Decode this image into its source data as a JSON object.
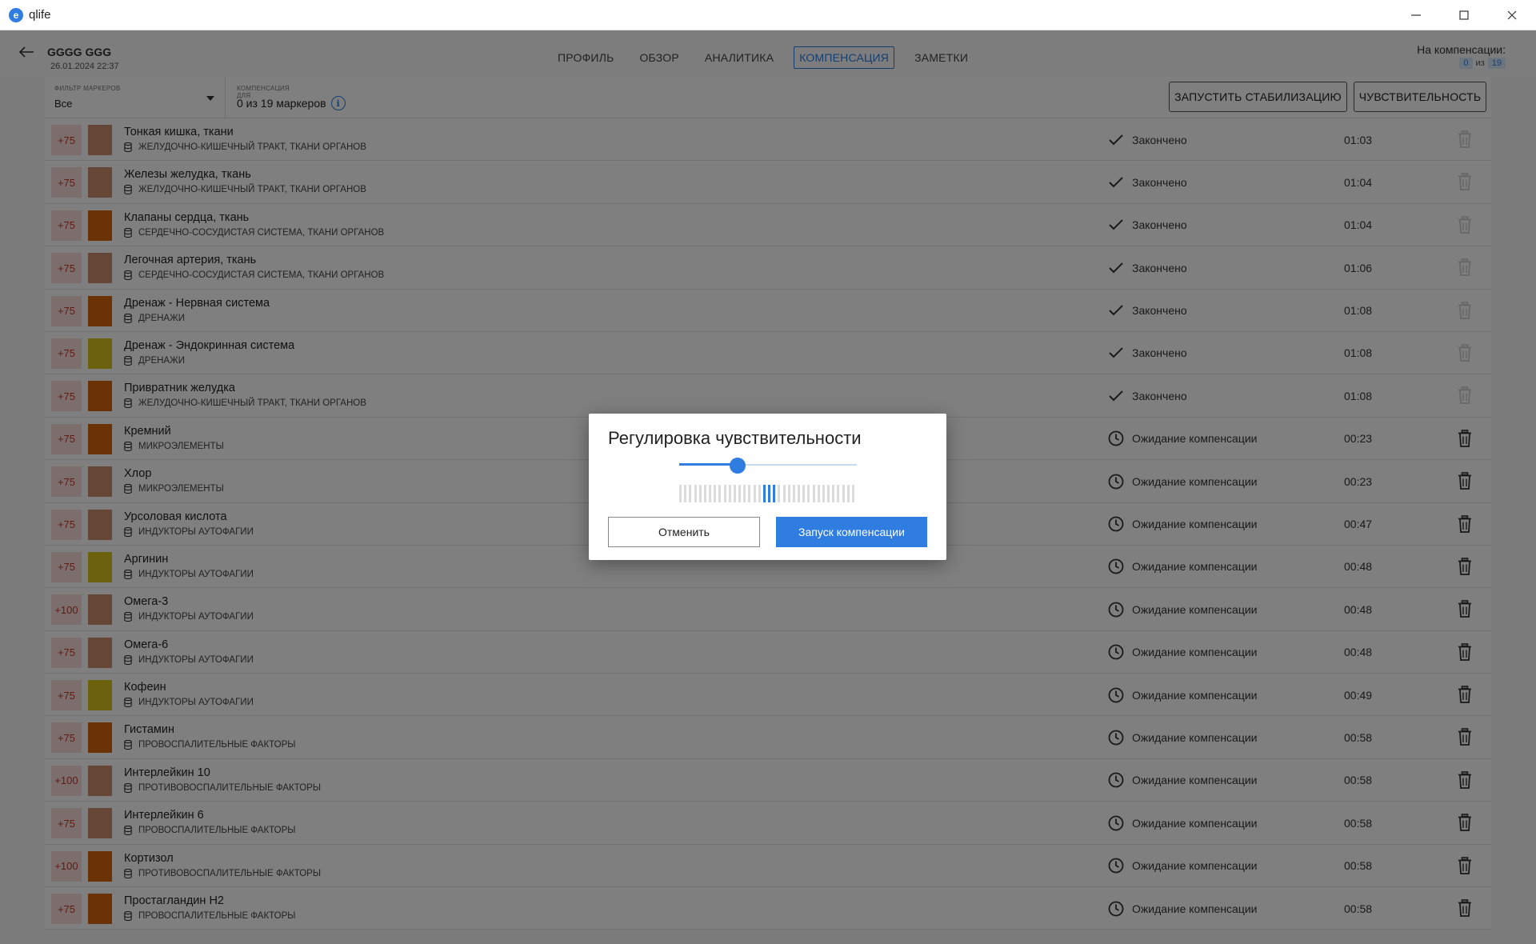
{
  "window": {
    "title": "qlife",
    "logo_letter": "e"
  },
  "header": {
    "patient_name": "GGGG GGG",
    "patient_date": "26.01.2024 22:37",
    "tabs": [
      {
        "label": "ПРОФИЛЬ"
      },
      {
        "label": "ОБЗОР"
      },
      {
        "label": "АНАЛИТИКА"
      },
      {
        "label": "КОМПЕНСАЦИЯ"
      },
      {
        "label": "ЗАМЕТКИ"
      }
    ],
    "active_tab": "КОМПЕНСАЦИЯ",
    "counter_label": "На компенсации:",
    "counter_done": "0",
    "counter_of": "из",
    "counter_total": "19"
  },
  "filterbar": {
    "filter_label": "ФИЛЬТР МАРКЕРОВ",
    "filter_value": "Все",
    "comp_label": "КОМПЕНСАЦИЯ ДЛЯ",
    "comp_value": "0 из 19 маркеров",
    "stabilize_label": "ЗАПУСТИТЬ СТАБИЛИЗАЦИЮ",
    "sensitivity_label": "ЧУВСТВИТЕЛЬНОСТЬ"
  },
  "colors": {
    "accent": "#2f7de1",
    "swatch_brown": "#cc8f6e",
    "swatch_orange": "#d6640c",
    "swatch_yellow": "#d9c21a",
    "score_text": "#c0392b",
    "score_bg": "#f7dcd9"
  },
  "rows": [
    {
      "score": "+75",
      "swatch": "brown",
      "name": "Тонкая кишка, ткани",
      "category": "ЖЕЛУДОЧНО-КИШЕЧНЫЙ ТРАКТ, ТКАНИ ОРГАНОВ",
      "status": "Закончено",
      "status_icon": "check-icon",
      "time": "01:03",
      "done": true
    },
    {
      "score": "+75",
      "swatch": "brown",
      "name": "Железы желудка, ткань",
      "category": "ЖЕЛУДОЧНО-КИШЕЧНЫЙ ТРАКТ, ТКАНИ ОРГАНОВ",
      "status": "Закончено",
      "status_icon": "check-icon",
      "time": "01:04",
      "done": true
    },
    {
      "score": "+75",
      "swatch": "orange",
      "name": "Клапаны сердца, ткань",
      "category": "СЕРДЕЧНО-СОСУДИСТАЯ СИСТЕМА, ТКАНИ ОРГАНОВ",
      "status": "Закончено",
      "status_icon": "check-icon",
      "time": "01:04",
      "done": true
    },
    {
      "score": "+75",
      "swatch": "brown",
      "name": "Легочная артерия, ткань",
      "category": "СЕРДЕЧНО-СОСУДИСТАЯ СИСТЕМА, ТКАНИ ОРГАНОВ",
      "status": "Закончено",
      "status_icon": "check-icon",
      "time": "01:06",
      "done": true
    },
    {
      "score": "+75",
      "swatch": "orange",
      "name": "Дренаж - Нервная система",
      "category": "ДРЕНАЖИ",
      "status": "Закончено",
      "status_icon": "check-icon",
      "time": "01:08",
      "done": true
    },
    {
      "score": "+75",
      "swatch": "yellow",
      "name": "Дренаж - Эндокринная система",
      "category": "ДРЕНАЖИ",
      "status": "Закончено",
      "status_icon": "check-icon",
      "time": "01:08",
      "done": true
    },
    {
      "score": "+75",
      "swatch": "orange",
      "name": "Привратник желудка",
      "category": "ЖЕЛУДОЧНО-КИШЕЧНЫЙ ТРАКТ, ТКАНИ ОРГАНОВ",
      "status": "Закончено",
      "status_icon": "check-icon",
      "time": "01:08",
      "done": true
    },
    {
      "score": "+75",
      "swatch": "orange",
      "name": "Кремний",
      "category": "МИКРОЭЛЕМЕНТЫ",
      "status": "Ожидание компенсации",
      "status_icon": "clock-icon",
      "time": "00:23",
      "done": false
    },
    {
      "score": "+75",
      "swatch": "brown",
      "name": "Хлор",
      "category": "МИКРОЭЛЕМЕНТЫ",
      "status": "Ожидание компенсации",
      "status_icon": "clock-icon",
      "time": "00:23",
      "done": false
    },
    {
      "score": "+75",
      "swatch": "brown",
      "name": "Урсоловая кислота",
      "category": "ИНДУКТОРЫ АУТОФАГИИ",
      "status": "Ожидание компенсации",
      "status_icon": "clock-icon",
      "time": "00:47",
      "done": false
    },
    {
      "score": "+75",
      "swatch": "yellow",
      "name": "Аргинин",
      "category": "ИНДУКТОРЫ АУТОФАГИИ",
      "status": "Ожидание компенсации",
      "status_icon": "clock-icon",
      "time": "00:48",
      "done": false
    },
    {
      "score": "+100",
      "swatch": "brown",
      "name": "Омега-3",
      "category": "ИНДУКТОРЫ АУТОФАГИИ",
      "status": "Ожидание компенсации",
      "status_icon": "clock-icon",
      "time": "00:48",
      "done": false
    },
    {
      "score": "+75",
      "swatch": "brown",
      "name": "Омега-6",
      "category": "ИНДУКТОРЫ АУТОФАГИИ",
      "status": "Ожидание компенсации",
      "status_icon": "clock-icon",
      "time": "00:48",
      "done": false
    },
    {
      "score": "+75",
      "swatch": "yellow",
      "name": "Кофеин",
      "category": "ИНДУКТОРЫ АУТОФАГИИ",
      "status": "Ожидание компенсации",
      "status_icon": "clock-icon",
      "time": "00:49",
      "done": false
    },
    {
      "score": "+75",
      "swatch": "orange",
      "name": "Гистамин",
      "category": "ПРОВОСПАЛИТЕЛЬНЫЕ ФАКТОРЫ",
      "status": "Ожидание компенсации",
      "status_icon": "clock-icon",
      "time": "00:58",
      "done": false
    },
    {
      "score": "+100",
      "swatch": "brown",
      "name": "Интерлейкин 10",
      "category": "ПРОТИВОВОСПАЛИТЕЛЬНЫЕ ФАКТОРЫ",
      "status": "Ожидание компенсации",
      "status_icon": "clock-icon",
      "time": "00:58",
      "done": false
    },
    {
      "score": "+75",
      "swatch": "brown",
      "name": "Интерлейкин 6",
      "category": "ПРОВОСПАЛИТЕЛЬНЫЕ ФАКТОРЫ",
      "status": "Ожидание компенсации",
      "status_icon": "clock-icon",
      "time": "00:58",
      "done": false
    },
    {
      "score": "+100",
      "swatch": "orange",
      "name": "Кортизол",
      "category": "ПРОТИВОВОСПАЛИТЕЛЬНЫЕ ФАКТОРЫ",
      "status": "Ожидание компенсации",
      "status_icon": "clock-icon",
      "time": "00:58",
      "done": false
    },
    {
      "score": "+75",
      "swatch": "orange",
      "name": "Простагландин Н2",
      "category": "ПРОВОСПАЛИТЕЛЬНЫЕ ФАКТОРЫ",
      "status": "Ожидание компенсации",
      "status_icon": "clock-icon",
      "time": "00:58",
      "done": false
    }
  ],
  "modal": {
    "title": "Регулировка чувствительности",
    "slider_level": 0.33,
    "meter_bars": 36,
    "meter_active": [
      17,
      18,
      19
    ],
    "cancel_label": "Отменить",
    "confirm_label": "Запуск компенсации"
  }
}
